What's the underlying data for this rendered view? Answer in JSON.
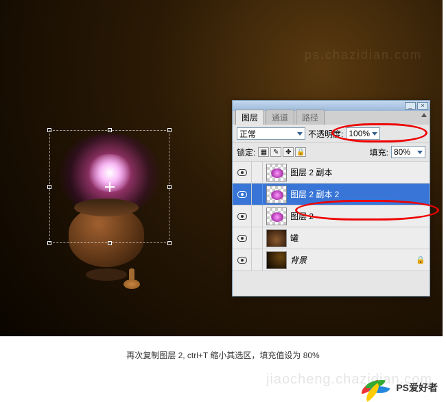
{
  "canvas": {
    "watermark": "ps.chazidian.com"
  },
  "panel": {
    "tabs": {
      "layers": "图层",
      "channels": "通道",
      "paths": "路径"
    },
    "blend_mode": "正常",
    "opacity_label": "不透明度:",
    "opacity_value": "100%",
    "lock_label": "锁定:",
    "fill_label": "填充:",
    "fill_value": "80%",
    "titlebar": {
      "min": "_",
      "close": "×"
    }
  },
  "layers": [
    {
      "name": "图层 2 副本",
      "thumb": "glow",
      "selected": false
    },
    {
      "name": "图层 2 副本 2",
      "thumb": "glow",
      "selected": true
    },
    {
      "name": "图层 2",
      "thumb": "glow",
      "selected": false
    },
    {
      "name": "罐",
      "thumb": "pot",
      "selected": false
    },
    {
      "name": "背景",
      "thumb": "bg",
      "selected": false,
      "locked": true,
      "italic": true
    }
  ],
  "caption": "再次复制图层 2, ctrl+T 缩小其选区，填充值设为 80%",
  "footer": {
    "brand": "PS爱好者",
    "watermark": "jiaocheng.chazidian.com"
  },
  "annotations": {
    "ring_color": "#e00"
  }
}
